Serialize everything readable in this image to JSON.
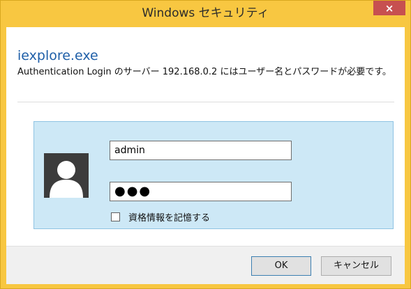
{
  "window": {
    "title": "Windows セキュリティ",
    "close_label": "×"
  },
  "app_name": "iexplore.exe",
  "message": "Authentication Login のサーバー 192.168.0.2 にはユーザー名とパスワードが必要です。",
  "credentials": {
    "username_value": "admin",
    "password_value": "●●●",
    "remember_label": "資格情報を記憶する",
    "remember_checked": false
  },
  "buttons": {
    "ok_label": "OK",
    "cancel_label": "キャンセル"
  },
  "colors": {
    "title_bar": "#f8c741",
    "close_button": "#c75050",
    "app_name": "#1f5fa8",
    "panel_bg": "#cde8f6",
    "panel_border": "#8fc3e3"
  },
  "icons": {
    "avatar": "user-avatar-icon",
    "close": "close-icon"
  }
}
